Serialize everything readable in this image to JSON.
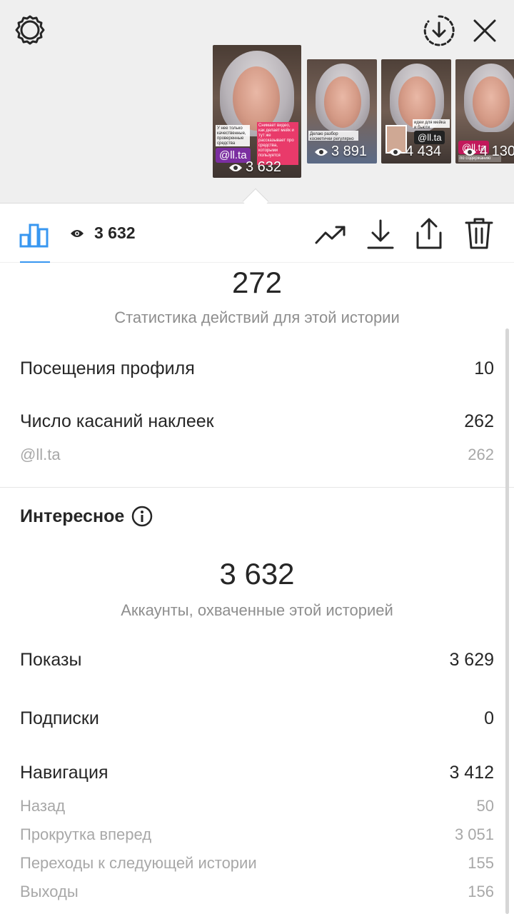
{
  "header": {
    "icons": {
      "settings": "gear-icon",
      "download": "download-circle-icon",
      "close": "close-icon"
    },
    "stories": [
      {
        "views": "3 632",
        "mention": "@ll.ta",
        "caption1": "У нее только качественные, проверенные средства",
        "caption2": "Снимает видео, как делает мейк и тут же рассказывает про средства, которыми пользуется"
      },
      {
        "views": "3 891",
        "caption1": "Делаю разбор косметички регулярно"
      },
      {
        "views": "4 434",
        "mention": "@ll.ta",
        "caption1": "идеи для мейка и бьюти"
      },
      {
        "views": "4 130",
        "mention": "@ll.ta",
        "caption1": "по содержанию"
      }
    ]
  },
  "toolbar": {
    "view_count": "3 632",
    "icons": [
      "bar-chart-icon",
      "eye-icon",
      "trending-icon",
      "download-icon",
      "share-icon",
      "trash-icon"
    ]
  },
  "actions": {
    "total": "272",
    "subtitle": "Статистика действий для этой истории",
    "rows": [
      {
        "label": "Посещения профиля",
        "value": "10"
      },
      {
        "label": "Число касаний наклеек",
        "value": "262"
      }
    ],
    "sub_rows": [
      {
        "label": "@ll.ta",
        "value": "262"
      }
    ]
  },
  "discovery": {
    "title": "Интересное",
    "reach": "3 632",
    "reach_label": "Аккаунты, охваченные этой историей",
    "rows": [
      {
        "label": "Показы",
        "value": "3 629"
      },
      {
        "label": "Подписки",
        "value": "0"
      },
      {
        "label": "Навигация",
        "value": "3 412"
      }
    ],
    "nav_rows": [
      {
        "label": "Назад",
        "value": "50"
      },
      {
        "label": "Прокрутка вперед",
        "value": "3 051"
      },
      {
        "label": "Переходы к следующей истории",
        "value": "155"
      },
      {
        "label": "Выходы",
        "value": "156"
      }
    ]
  },
  "colors": {
    "accent": "#3897f0",
    "text": "#262626",
    "muted": "#8e8e8e",
    "sticker": "#7b2ea0"
  }
}
